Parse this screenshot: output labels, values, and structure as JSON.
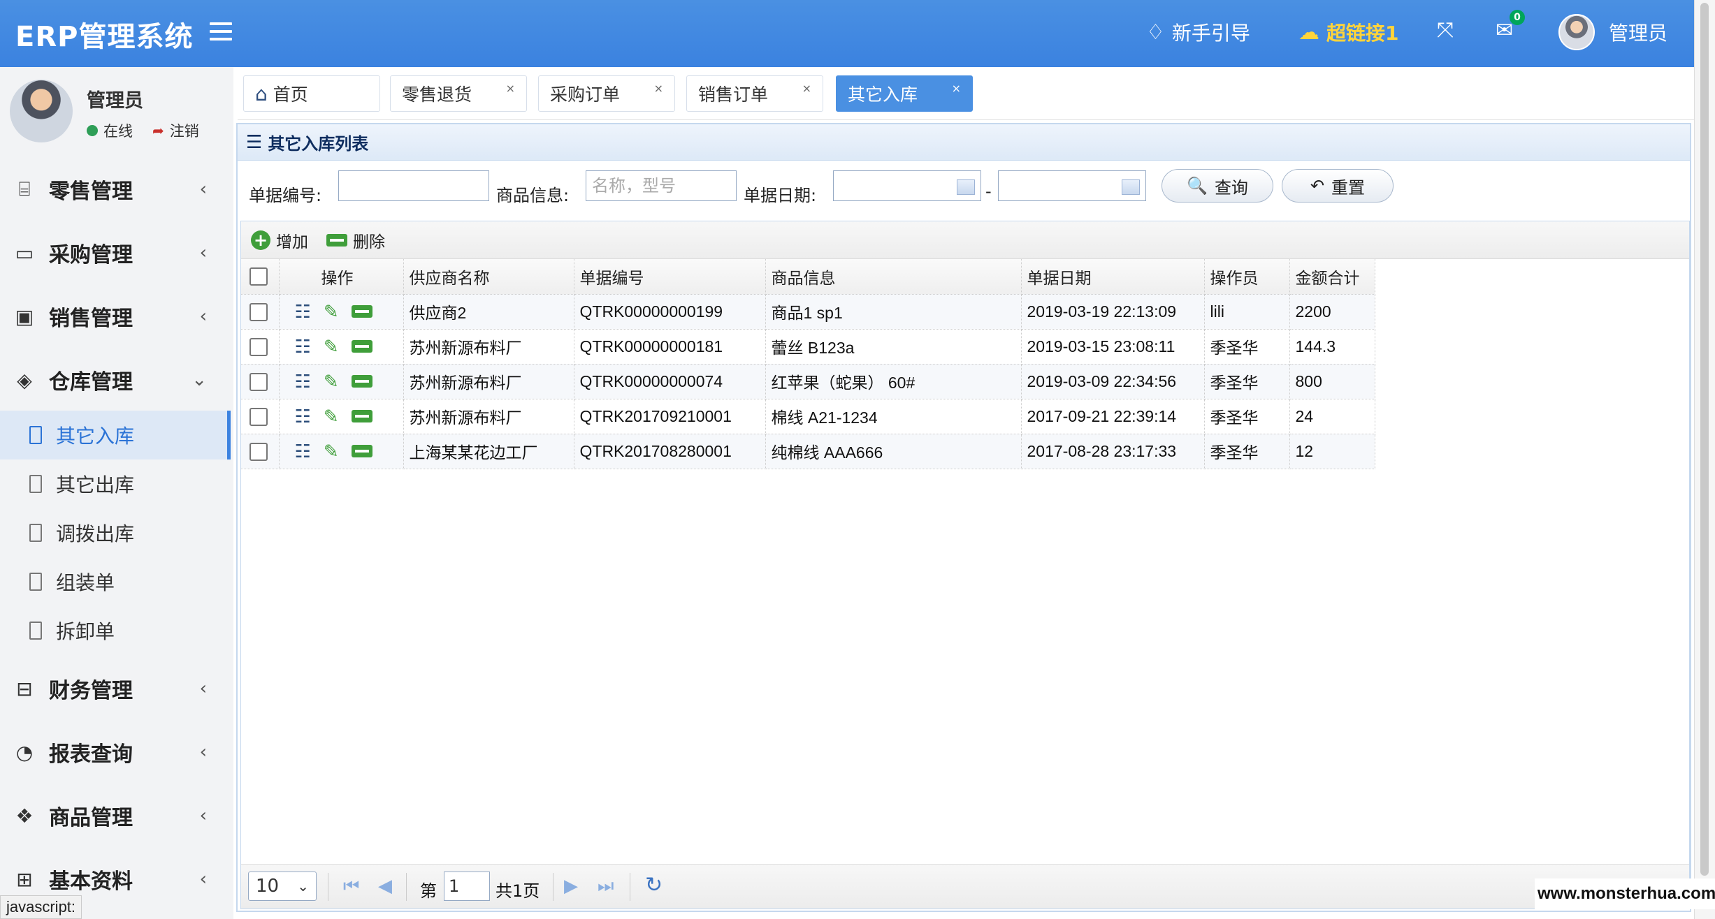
{
  "header": {
    "brand": "ERP管理系统",
    "guide": "新手引导",
    "link1": "超链接1",
    "mail_count": "0",
    "user": "管理员"
  },
  "sidebar": {
    "user_name": "管理员",
    "status_online": "在线",
    "logout": "注销",
    "menu": [
      {
        "label": "零售管理",
        "icon": "gift-icon"
      },
      {
        "label": "采购管理",
        "icon": "monitor-icon"
      },
      {
        "label": "销售管理",
        "icon": "briefcase-icon"
      },
      {
        "label": "仓库管理",
        "icon": "layers-icon"
      },
      {
        "label": "财务管理",
        "icon": "book-icon"
      },
      {
        "label": "报表查询",
        "icon": "pie-icon"
      },
      {
        "label": "商品管理",
        "icon": "dropbox-icon"
      },
      {
        "label": "基本资料",
        "icon": "grid-icon"
      }
    ],
    "warehouse_sub": [
      {
        "label": "其它入库",
        "active": true
      },
      {
        "label": "其它出库"
      },
      {
        "label": "调拨出库"
      },
      {
        "label": "组装单"
      },
      {
        "label": "拆卸单"
      }
    ],
    "status_bar": "javascript:"
  },
  "tabs": [
    {
      "label": "首页"
    },
    {
      "label": "零售退货"
    },
    {
      "label": "采购订单"
    },
    {
      "label": "销售订单"
    },
    {
      "label": "其它入库",
      "active": true
    }
  ],
  "tab_close": "×",
  "panel": {
    "title": "其它入库列表",
    "search": {
      "doc_no_label": "单据编号:",
      "doc_no_value": "",
      "goods_label": "商品信息:",
      "goods_placeholder": "名称，型号",
      "date_label": "单据日期:",
      "date_start": "",
      "date_sep": "-",
      "date_end": "",
      "query_button": "查询",
      "reset_button": "重置"
    },
    "toolbar": {
      "add": "增加",
      "delete": "删除"
    },
    "columns": [
      "操作",
      "供应商名称",
      "单据编号",
      "商品信息",
      "单据日期",
      "操作员",
      "金额合计"
    ],
    "rows": [
      {
        "supplier": "供应商2",
        "doc_no": "QTRK00000000199",
        "goods": "商品1 sp1",
        "date": "2019-03-19 22:13:09",
        "operator": "lili",
        "amount": "2200"
      },
      {
        "supplier": "苏州新源布料厂",
        "doc_no": "QTRK00000000181",
        "goods": "蕾丝 B123a",
        "date": "2019-03-15 23:08:11",
        "operator": "季圣华",
        "amount": "144.3"
      },
      {
        "supplier": "苏州新源布料厂",
        "doc_no": "QTRK00000000074",
        "goods": "红苹果（蛇果） 60#",
        "date": "2019-03-09 22:34:56",
        "operator": "季圣华",
        "amount": "800"
      },
      {
        "supplier": "苏州新源布料厂",
        "doc_no": "QTRK201709210001",
        "goods": "棉线 A21-1234",
        "date": "2017-09-21 22:39:14",
        "operator": "季圣华",
        "amount": "24"
      },
      {
        "supplier": "上海某某花边工厂",
        "doc_no": "QTRK201708280001",
        "goods": "纯棉线 AAA666",
        "date": "2017-08-28 23:17:33",
        "operator": "季圣华",
        "amount": "12"
      }
    ],
    "pager": {
      "page_size": "10",
      "page_prefix": "第",
      "page_value": "1",
      "page_total": "共1页"
    }
  },
  "watermark": "www.monsterhua.com",
  "colors": {
    "header": "#4a90e2",
    "active_tab": "#4a90e2",
    "active_sub": "#2b73d6",
    "green_action": "#3f9e3a",
    "link_yellow": "#ffd43b"
  }
}
